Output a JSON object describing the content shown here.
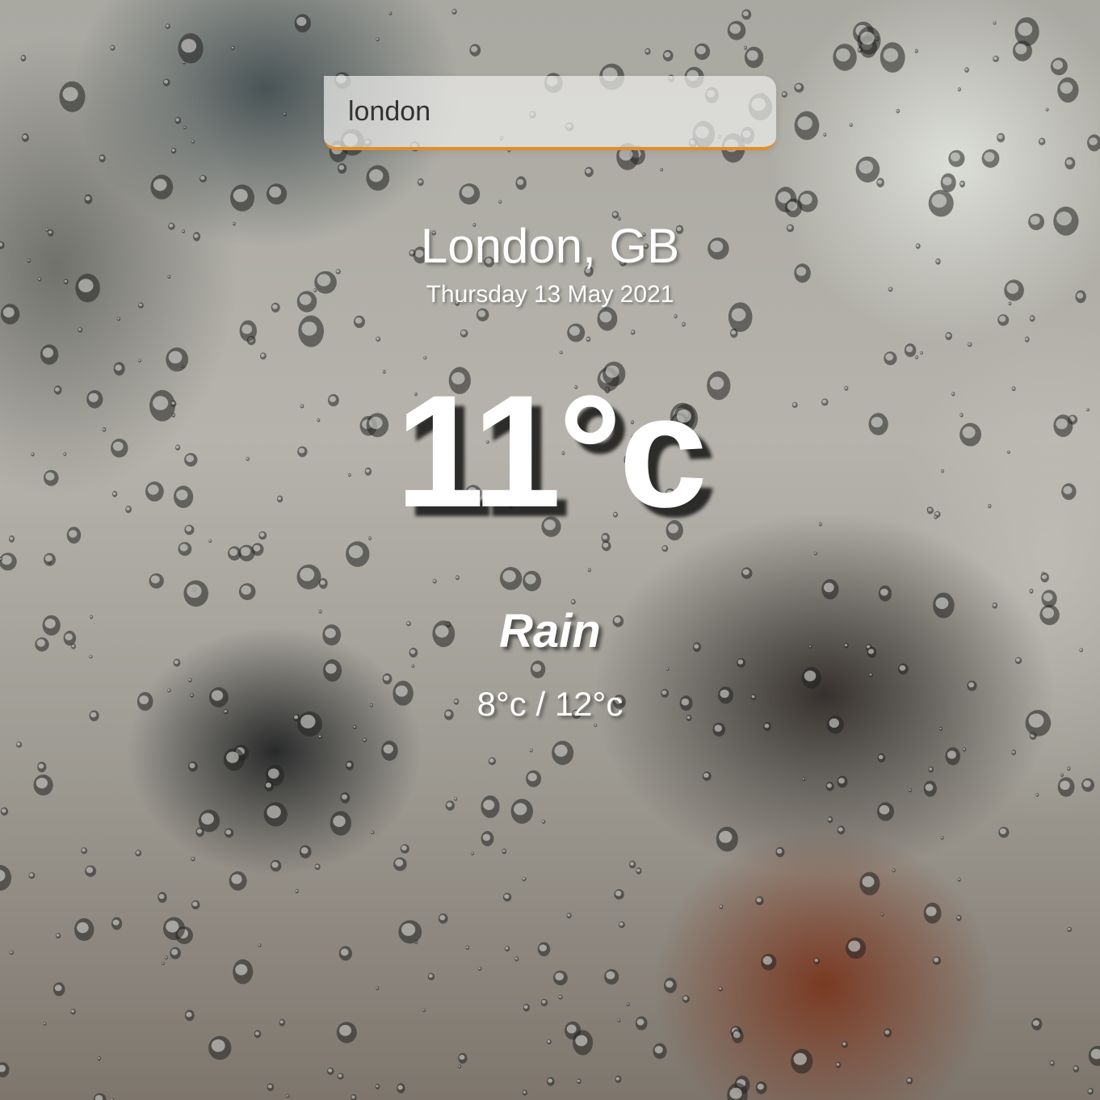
{
  "search": {
    "value": "london"
  },
  "location": {
    "city": "London, GB",
    "date": "Thursday 13 May 2021"
  },
  "weather": {
    "temperature": "11°c",
    "condition": "Rain",
    "hi_low": "8°c / 12°c"
  },
  "colors": {
    "search_underline": "#df8f2a",
    "text": "#ffffff"
  }
}
